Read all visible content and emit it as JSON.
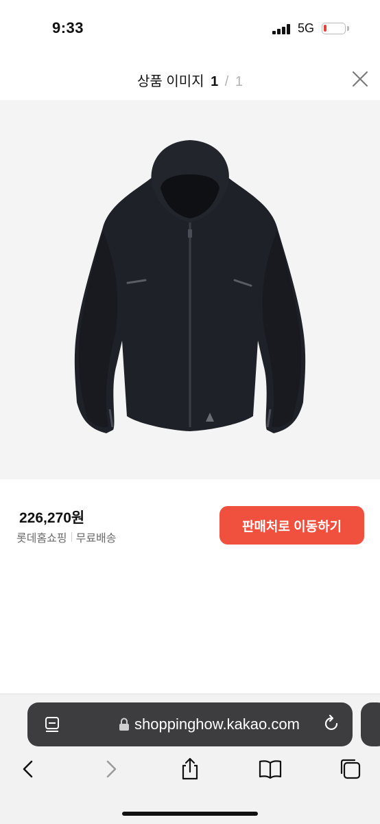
{
  "status_bar": {
    "time": "9:33",
    "network": "5G",
    "battery_level": 0.15,
    "icons": [
      "signal-icon",
      "battery-icon"
    ]
  },
  "header": {
    "title_label": "상품 이미지",
    "current_index": "1",
    "separator": "/",
    "total": "1",
    "close_icon": "close-icon"
  },
  "product": {
    "image_alt": "black hooded jacket",
    "price": "226,270원",
    "seller": "롯데홈쇼핑",
    "shipping": "무료배송",
    "cta_label": "판매처로 이동하기"
  },
  "browser": {
    "url": "shoppinghow.kakao.com",
    "icons": [
      "reader-icon",
      "lock-icon",
      "reload-icon",
      "back-icon",
      "forward-icon",
      "share-icon",
      "bookmarks-icon",
      "tabs-icon"
    ]
  },
  "colors": {
    "accent": "#f0513e",
    "url_bar": "#3d3d3f",
    "image_bg": "#f4f4f4"
  }
}
